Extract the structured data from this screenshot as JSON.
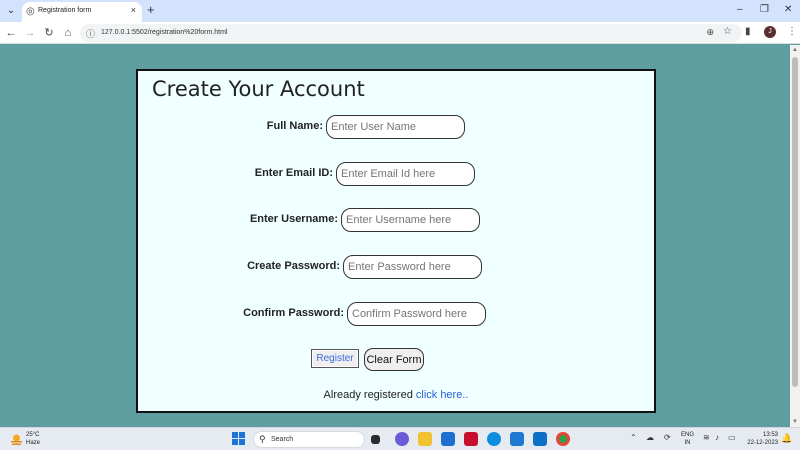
{
  "browser": {
    "tab_title": "Registration form",
    "tab_close": "×",
    "new_tab": "+",
    "url": "127.0.0.1:5502/registration%20form.html",
    "window_controls": [
      "–",
      "❐",
      "✕"
    ],
    "profile_initial": "J"
  },
  "form": {
    "title": "Create Your Account",
    "fields": [
      {
        "label": "Full Name:",
        "placeholder": "Enter User Name"
      },
      {
        "label": "Enter Email ID:",
        "placeholder": "Enter Email Id here"
      },
      {
        "label": "Enter Username:",
        "placeholder": "Enter Username here"
      },
      {
        "label": "Create Password:",
        "placeholder": "Enter Password here"
      },
      {
        "label": "Confirm Password:",
        "placeholder": "Confirm Password here"
      }
    ],
    "register_label": "Register",
    "clear_label": "Clear Form",
    "already_text": "Already registered ",
    "click_here": "click here.."
  },
  "taskbar": {
    "temperature": "25°C",
    "condition": "Haze",
    "search_label": "Search",
    "lang_top": "ENG",
    "lang_bottom": "IN",
    "time": "13:53",
    "date": "22-12-2023"
  },
  "colors": {
    "page_bg": "#5f9ea0",
    "form_bg": "#f0ffff",
    "link": "#2962d4"
  }
}
